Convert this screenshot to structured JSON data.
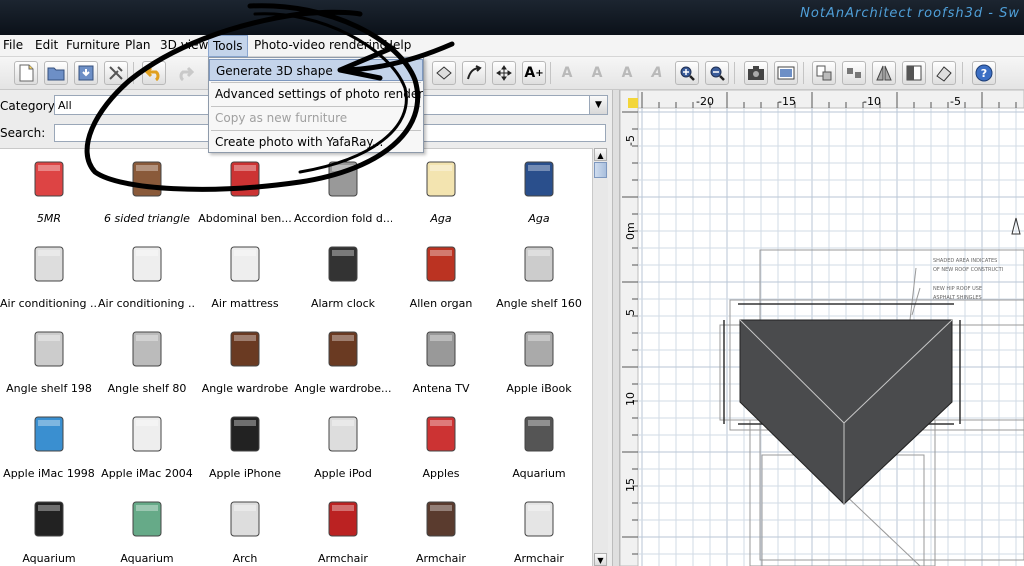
{
  "window": {
    "title": "NotAnArchitect roofsh3d - Sw"
  },
  "menubar": {
    "items": [
      {
        "label": "File"
      },
      {
        "label": "Edit"
      },
      {
        "label": "Furniture"
      },
      {
        "label": "Plan"
      },
      {
        "label": "3D view"
      },
      {
        "label": "Tools"
      },
      {
        "label": "Photo-video rendering"
      },
      {
        "label": "Help"
      }
    ],
    "active": "Tools"
  },
  "tools_menu": {
    "items": [
      {
        "label": "Generate 3D shape",
        "state": "highlighted"
      },
      {
        "label": "Advanced settings of photo rendering",
        "state": "enabled"
      },
      {
        "label": "Copy as new furniture",
        "state": "disabled"
      },
      {
        "label": "Create photo with YafaRay...",
        "state": "enabled"
      }
    ]
  },
  "toolbar": {
    "buttons": [
      {
        "icon": "new-home-icon"
      },
      {
        "icon": "open-icon"
      },
      {
        "icon": "save-icon"
      },
      {
        "icon": "preferences-icon"
      },
      {
        "icon": "undo-icon"
      },
      {
        "icon": "redo-icon"
      },
      {
        "icon": "add-point-icon"
      },
      {
        "icon": "rotate-icon"
      },
      {
        "icon": "move-icon"
      },
      {
        "icon": "add-text-icon"
      },
      {
        "icon": "text-style-icon"
      },
      {
        "icon": "text-bold-icon"
      },
      {
        "icon": "text-italic-icon"
      },
      {
        "icon": "text-size-icon"
      },
      {
        "icon": "zoom-in-icon"
      },
      {
        "icon": "zoom-out-icon"
      },
      {
        "icon": "camera-icon"
      },
      {
        "icon": "photo-icon"
      },
      {
        "icon": "import-icon"
      },
      {
        "icon": "group-icon"
      },
      {
        "icon": "flip-icon"
      },
      {
        "icon": "frame-icon"
      },
      {
        "icon": "eraser-icon"
      },
      {
        "icon": "help-icon"
      }
    ]
  },
  "catalog": {
    "category_label": "Category:",
    "category_value": "All",
    "search_label": "Search:",
    "search_value": "",
    "items": [
      {
        "label": "5MR",
        "italic": true,
        "icon": "chair-model-icon"
      },
      {
        "label": "6 sided triangle",
        "italic": true,
        "icon": "box-model-icon"
      },
      {
        "label": "Abdominal ben...",
        "italic": false,
        "icon": "bench-icon"
      },
      {
        "label": "Accordion fold d...",
        "italic": false,
        "icon": "door-icon"
      },
      {
        "label": "Aga",
        "italic": true,
        "icon": "stove-icon"
      },
      {
        "label": "Aga",
        "italic": true,
        "icon": "stove-blue-icon"
      },
      {
        "label": "Air conditioning ...",
        "italic": false,
        "icon": "ac-unit-icon"
      },
      {
        "label": "Air conditioning ...",
        "italic": false,
        "icon": "ac-wall-icon"
      },
      {
        "label": "Air mattress",
        "italic": false,
        "icon": "mattress-icon"
      },
      {
        "label": "Alarm clock",
        "italic": false,
        "icon": "clock-icon"
      },
      {
        "label": "Allen organ",
        "italic": false,
        "icon": "organ-icon"
      },
      {
        "label": "Angle shelf 160",
        "italic": false,
        "icon": "shelf-icon"
      },
      {
        "label": "Angle shelf 198",
        "italic": false,
        "icon": "shelf-icon"
      },
      {
        "label": "Angle shelf 80",
        "italic": false,
        "icon": "shelf-low-icon"
      },
      {
        "label": "Angle wardrobe",
        "italic": false,
        "icon": "wardrobe-icon"
      },
      {
        "label": "Angle wardrobe...",
        "italic": false,
        "icon": "wardrobe-icon"
      },
      {
        "label": "Antena TV",
        "italic": false,
        "icon": "antenna-icon"
      },
      {
        "label": "Apple iBook",
        "italic": false,
        "icon": "laptop-icon"
      },
      {
        "label": "Apple iMac 1998",
        "italic": false,
        "icon": "imac-icon"
      },
      {
        "label": "Apple iMac 2004",
        "italic": false,
        "icon": "imac-white-icon"
      },
      {
        "label": "Apple iPhone",
        "italic": false,
        "icon": "phone-icon"
      },
      {
        "label": "Apple iPod",
        "italic": false,
        "icon": "ipod-icon"
      },
      {
        "label": "Apples",
        "italic": false,
        "icon": "apples-icon"
      },
      {
        "label": "Aquarium",
        "italic": false,
        "icon": "aquarium-icon"
      },
      {
        "label": "Aquarium",
        "italic": false,
        "icon": "aquarium-stand-icon"
      },
      {
        "label": "Aquarium",
        "italic": false,
        "icon": "aquarium-plants-icon"
      },
      {
        "label": "Arch",
        "italic": false,
        "icon": "arch-icon"
      },
      {
        "label": "Armchair",
        "italic": false,
        "icon": "armchair-red-icon"
      },
      {
        "label": "Armchair",
        "italic": false,
        "icon": "armchair-brown-icon"
      },
      {
        "label": "Armchair",
        "italic": false,
        "icon": "armchair-white-icon"
      }
    ]
  },
  "plan": {
    "ruler_top": [
      "-20",
      "-15",
      "-10",
      "-5"
    ],
    "ruler_left": [
      "-5",
      "0m",
      "5",
      "10",
      "15"
    ],
    "annotations": [
      "SHADED AREA INDICATES",
      "OF NEW ROOF CONSTRUCTI",
      "NEW HIP ROOF USE",
      "ASPHALT SHINGLES"
    ]
  },
  "colors": {
    "menu_highlight": "#c4d4ea",
    "title_text": "#4f9fd8",
    "roof": "#4a4b4d"
  }
}
